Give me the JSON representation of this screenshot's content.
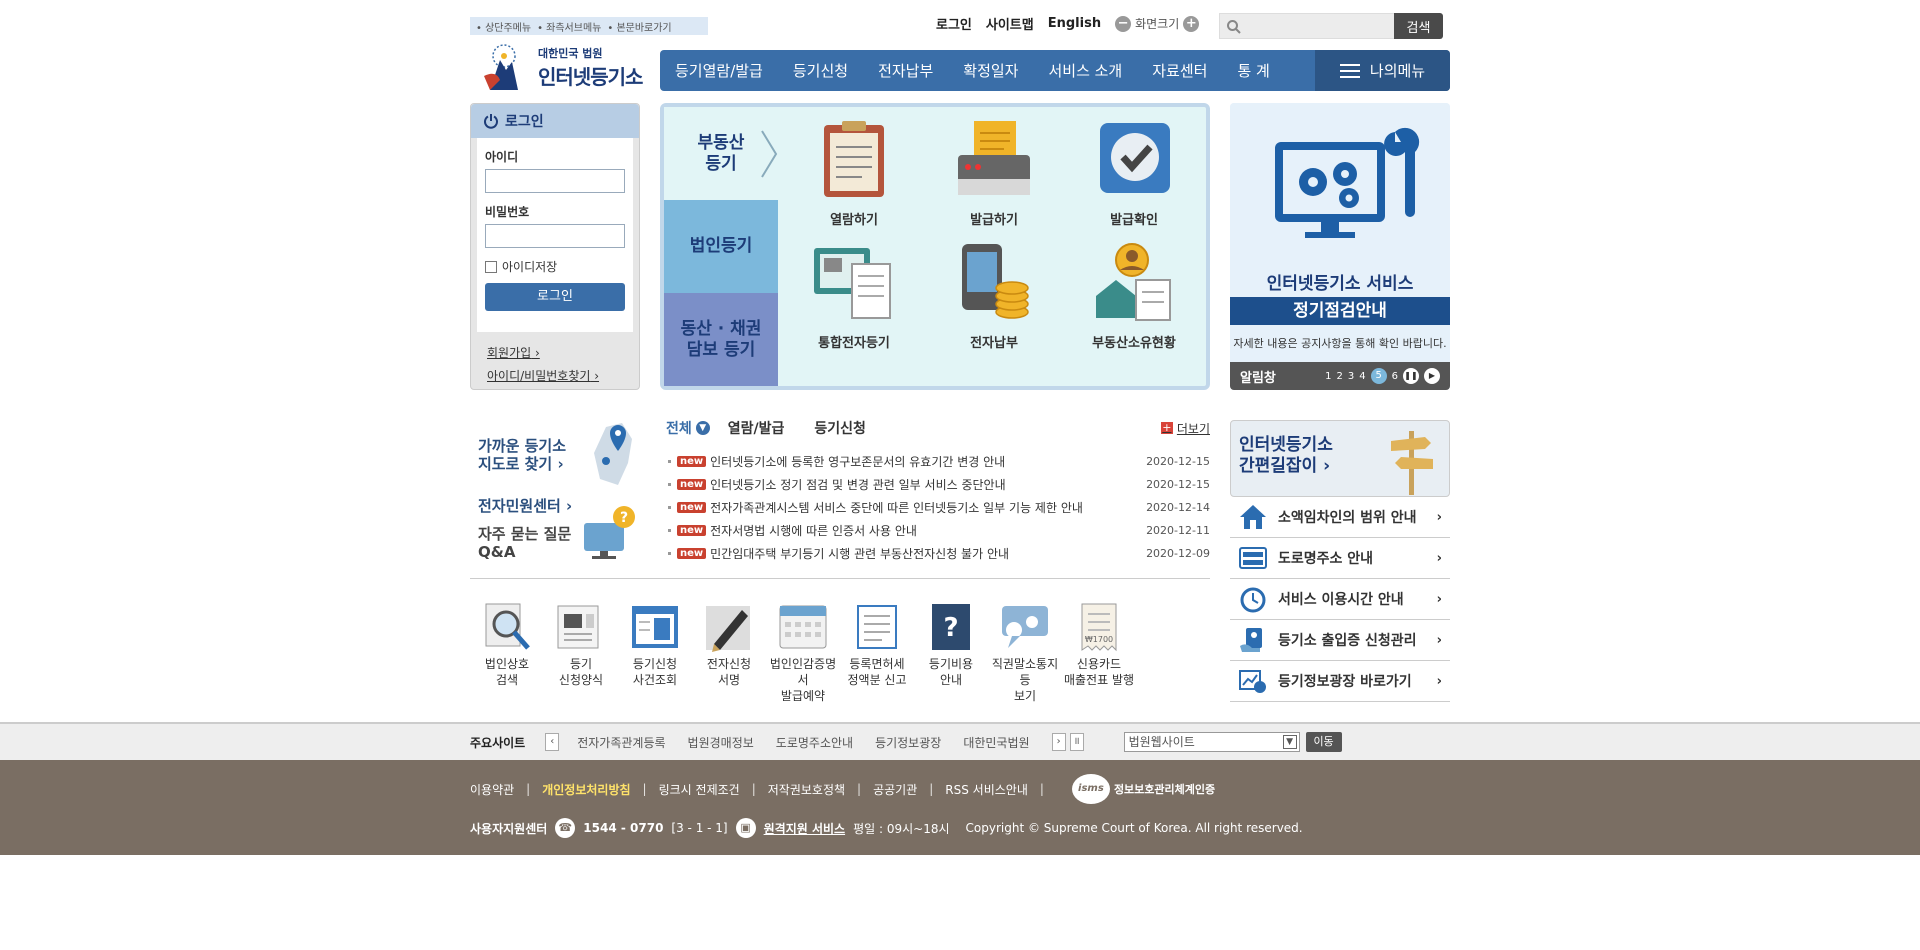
{
  "skip_links": [
    "상단주메뉴",
    "좌측서브메뉴",
    "본문바로가기"
  ],
  "util": {
    "login": "로그인",
    "sitemap": "사이트맵",
    "english": "English",
    "font_size": "화면크기",
    "search_button": "검색",
    "search_placeholder": ""
  },
  "logo": {
    "line1": "대한민국 법원",
    "line2": "인터넷등기소"
  },
  "gnb": {
    "items": [
      "등기열람/발급",
      "등기신청",
      "전자납부",
      "확정일자",
      "서비스 소개",
      "자료센터",
      "통 계"
    ],
    "mymenu": "나의메뉴"
  },
  "login": {
    "title": "로그인",
    "id_label": "아이디",
    "pw_label": "비밀번호",
    "save_id": "아이디저장",
    "button": "로그인",
    "join": "회원가입",
    "find": "아이디/비밀번호찾기"
  },
  "registry": {
    "tabs": [
      "부동산\n등기",
      "법인등기",
      "동산 · 채권\n담보 등기"
    ],
    "icons": [
      "열람하기",
      "발급하기",
      "발급확인",
      "통합전자등기",
      "전자납부",
      "부동산소유현황"
    ]
  },
  "banner": {
    "line1": "인터넷등기소 서비스",
    "line2": "정기점검안내",
    "line3": "자세한 내용은 공지사항을 통해 확인 바랍니다.",
    "bar_title": "알림창",
    "pages": [
      "1",
      "2",
      "3",
      "4",
      "5",
      "6"
    ],
    "current_page": "5"
  },
  "quick": {
    "nearby_1": "가까운 등기소",
    "nearby_2": "지도로 찾기",
    "center": "전자민원센터",
    "faq_1": "자주 묻는 질문",
    "faq_2": "Q&A"
  },
  "news": {
    "tabs": [
      "전체",
      "열람/발급",
      "등기신청"
    ],
    "more": "더보기",
    "badge": "new",
    "items": [
      {
        "title": "인터넷등기소에 등록한 영구보존문서의 유효기간 변경 안내",
        "date": "2020-12-15"
      },
      {
        "title": "인터넷등기소 정기 점검 및 변경 관련 일부 서비스 중단안내",
        "date": "2020-12-15"
      },
      {
        "title": "전자가족관계시스템 서비스 중단에 따른 인터넷등기소 일부 기능 제한 안내",
        "date": "2020-12-14"
      },
      {
        "title": "전자서명법 시행에 따른 인증서 사용 안내",
        "date": "2020-12-11"
      },
      {
        "title": "민간임대주택 부기등기 시행 관련 부동산전자신청 불가 안내",
        "date": "2020-12-09"
      }
    ]
  },
  "services": [
    {
      "l1": "법인상호",
      "l2": "검색"
    },
    {
      "l1": "등기",
      "l2": "신청양식"
    },
    {
      "l1": "등기신청",
      "l2": "사건조회"
    },
    {
      "l1": "전자신청",
      "l2": "서명"
    },
    {
      "l1": "법인인감증명서",
      "l2": "발급예약"
    },
    {
      "l1": "등록면허세",
      "l2": "정액분 신고"
    },
    {
      "l1": "등기비용",
      "l2": "안내"
    },
    {
      "l1": "직권말소통지등",
      "l2": "보기"
    },
    {
      "l1": "신용카드",
      "l2": "매출전표 발행"
    }
  ],
  "guide": {
    "line1": "인터넷등기소",
    "line2": "간편길잡이"
  },
  "right_links": [
    "소액임차인의 범위 안내",
    "도로명주소 안내",
    "서비스 이용시간 안내",
    "등기소 출입증 신청관리",
    "등기정보광장 바로가기"
  ],
  "sites": {
    "label": "주요사이트",
    "links": [
      "전자가족관계등록",
      "법원경매정보",
      "도로명주소안내",
      "등기정보광장",
      "대한민국법원"
    ],
    "select": "법원웹사이트",
    "go": "이동"
  },
  "footer": {
    "links": [
      "이용약관",
      "개인정보처리방침",
      "링크시 전제조건",
      "저작권보호정책",
      "공공기관",
      "RSS 서비스안내"
    ],
    "isms_seal": "isms",
    "isms": "정보보호관리체계인증",
    "center": "사용자지원센터",
    "phone": "1544 - 0770",
    "phone_ext": "[3 - 1 - 1]",
    "remote": "원격지원 서비스",
    "hours": "평일 : 09시~18시",
    "copyright": "Copyright © Supreme Court of Korea. All right reserved."
  },
  "colors": {
    "brand": "#3a6ea8",
    "brand_dark": "#1d3c78",
    "footer": "#7a6e63",
    "new_badge": "#c9412f"
  }
}
